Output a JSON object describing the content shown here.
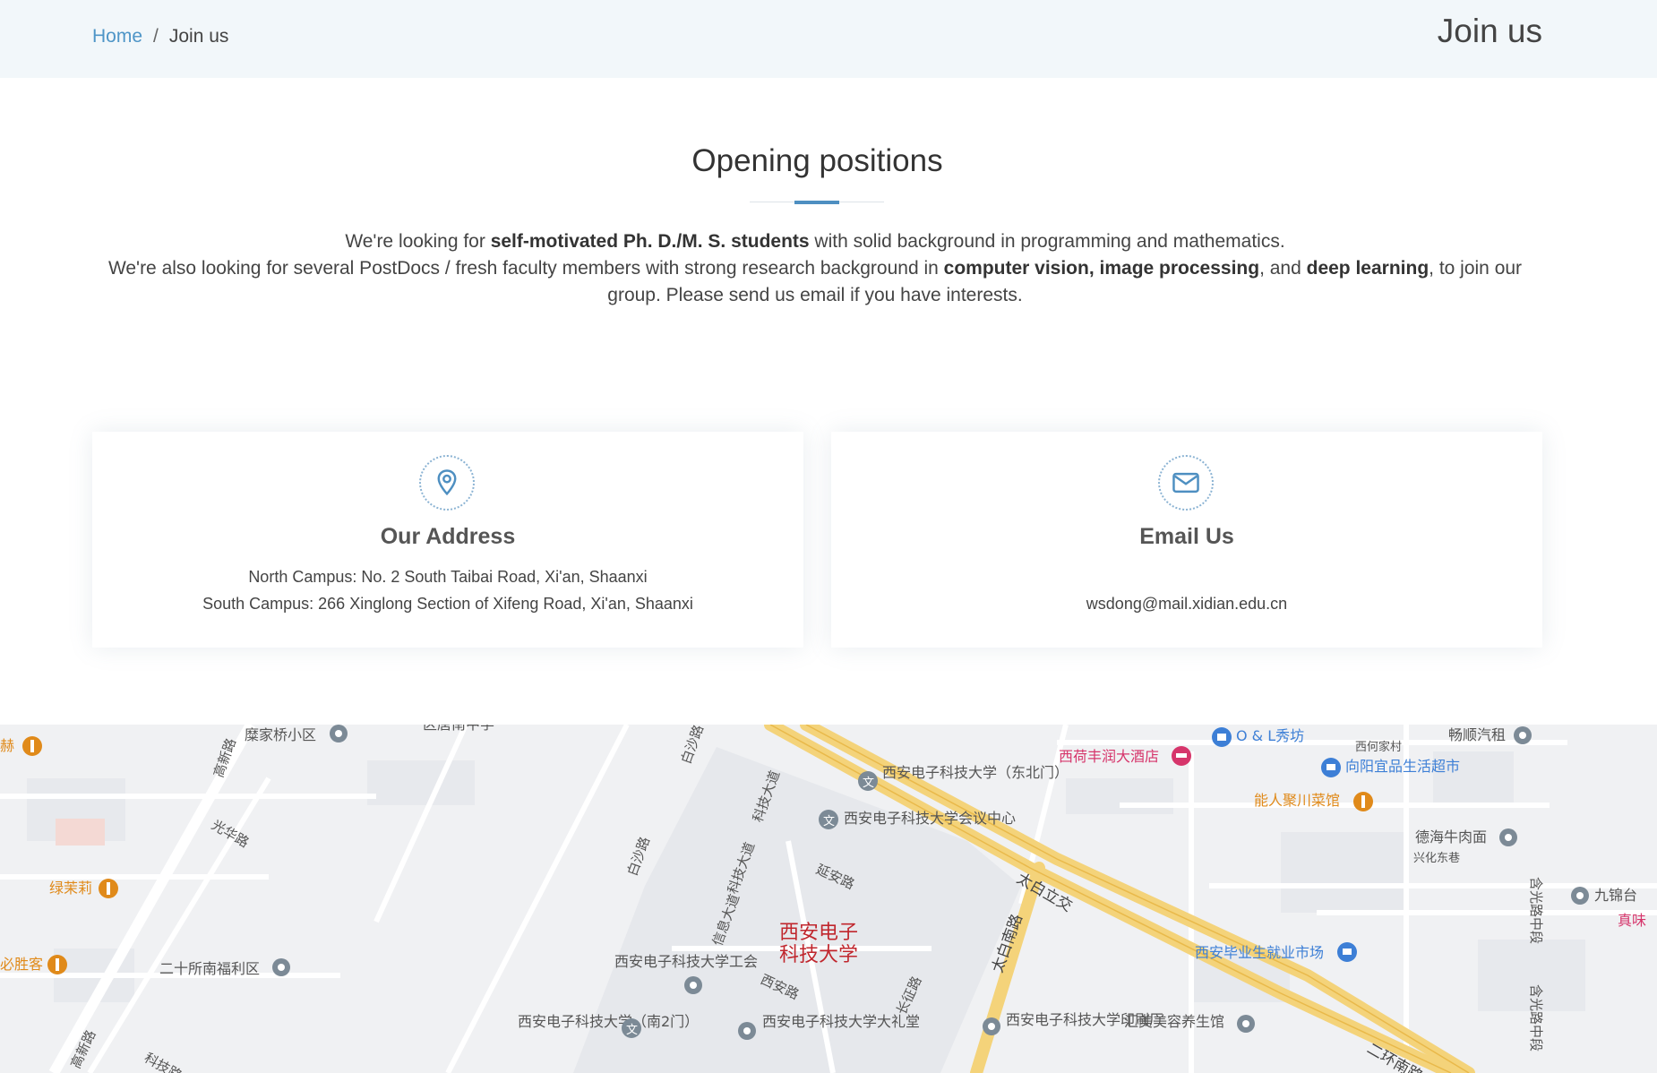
{
  "breadcrumb": {
    "home": "Home",
    "separator": "/",
    "current": "Join us"
  },
  "page_title": "Join us",
  "section": {
    "title": "Opening positions",
    "line1": {
      "a": "We're looking for ",
      "b": "self-motivated Ph. D./M. S. students",
      "c": " with solid background in programming and mathematics."
    },
    "line2": {
      "a": "We're also looking for several PostDocs / fresh faculty members with strong research background in ",
      "b": "computer vision, image processing",
      "c": ", and ",
      "d": "deep learning",
      "e": ", to join our group. Please send us email if you have interests."
    }
  },
  "address_box": {
    "icon": "map-pin-icon",
    "title": "Our Address",
    "north": "North Campus: No. 2 South Taibai Road, Xi'an, Shaanxi",
    "south": "South Campus: 266 Xinglong Section of Xifeng Road, Xi'an, Shaanxi"
  },
  "email_box": {
    "icon": "envelope-icon",
    "title": "Email Us",
    "email": "wsdong@mail.xidian.edu.cn"
  },
  "map": {
    "campus_label_1": "西安电子",
    "campus_label_2": "科技大学",
    "poi": {
      "p1": "糜家桥小区",
      "p2": "区唐南中学",
      "p3": "O & L秀坊",
      "p4": "西何家村",
      "p5": "畅顺汽租",
      "p6": "西荷丰润大酒店",
      "p7": "向阳宜品生活超市",
      "p8": "能人聚川菜馆",
      "p9": "德海牛肉面",
      "p10": "兴化东巷",
      "p11": "九锦台",
      "p12": "真味",
      "p13": "西安毕业生就业市场",
      "p14": "汇美美容养生馆",
      "p15": "西安电子科技大学印刷厂",
      "p16": "西安电子科技大学大礼堂",
      "p17": "西安电子科技大学（南2门）",
      "p18": "西安电子科技大学工会",
      "p19": "二十所南福利区",
      "p20": "必胜客",
      "p21": "绿茉莉",
      "p22": "西安电子科技大学（东北门）",
      "p23": "西安电子科技大学会议中心",
      "p24": "赫"
    },
    "roads": {
      "r1": "高新路",
      "r2": "光华路",
      "r3": "白沙路",
      "r4": "科技大道",
      "r5": "信息大道",
      "r6": "延安路",
      "r7": "西安路",
      "r8": "长征路",
      "r9": "太白立交",
      "r10": "太白南路",
      "r11": "二环南路",
      "r12": "含光路中段",
      "r13": "科技路",
      "r14": "白沙路"
    }
  }
}
